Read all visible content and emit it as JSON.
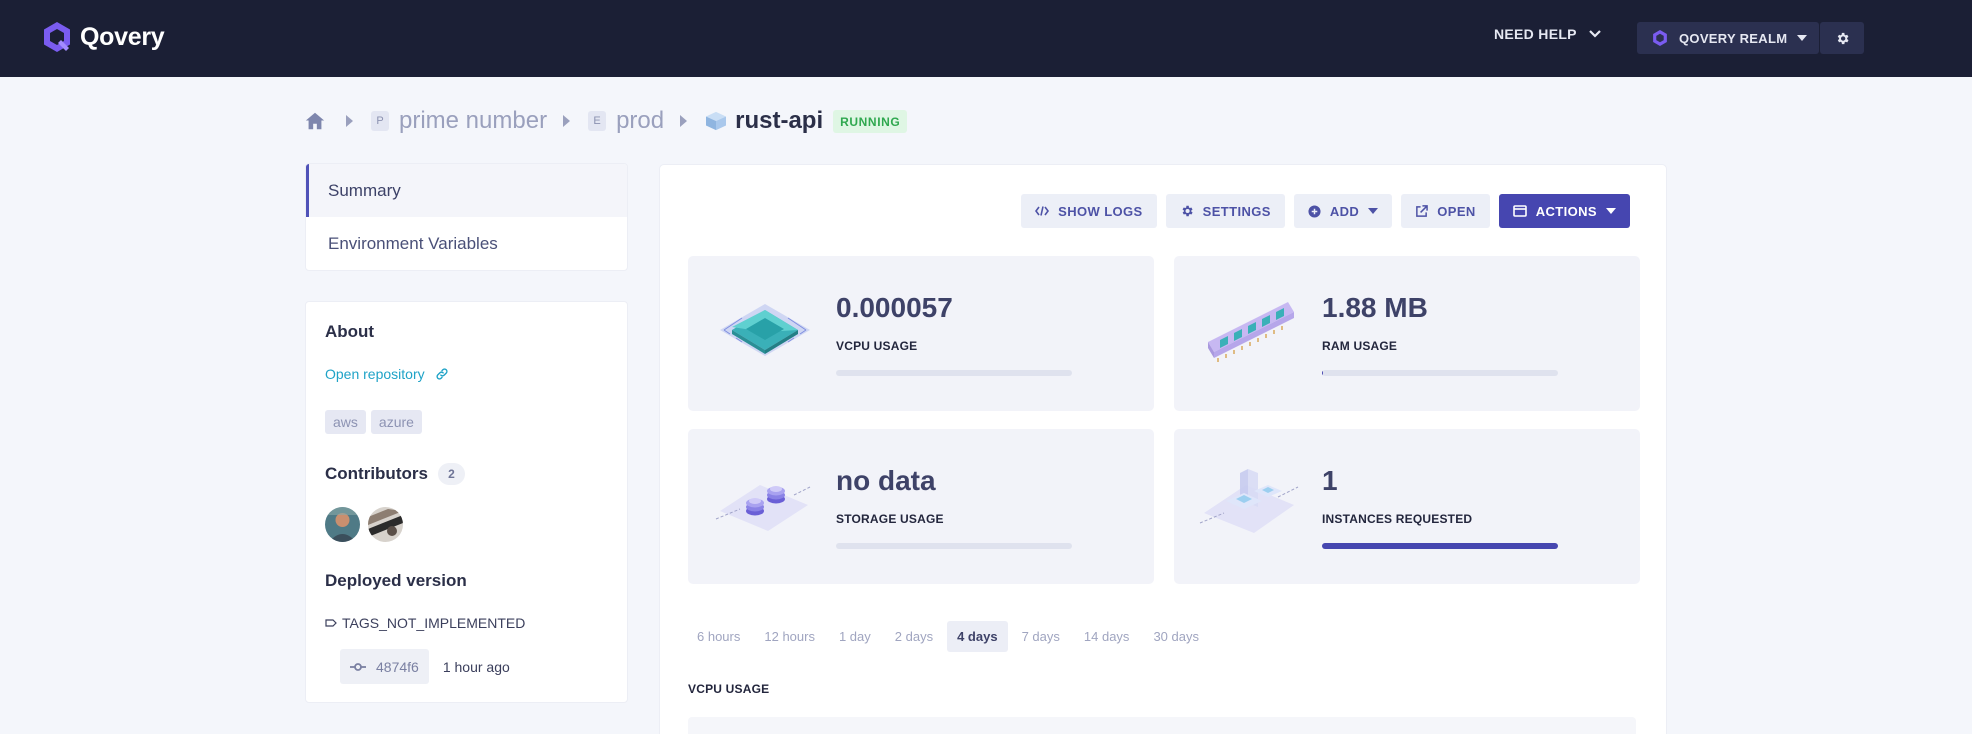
{
  "app": {
    "name": "Qovery"
  },
  "topbar": {
    "help_label": "NEED HELP",
    "realm_label": "QOVERY REALM"
  },
  "breadcrumb": {
    "project_letter": "P",
    "project": "prime number",
    "environment_letter": "E",
    "environment": "prod",
    "application": "rust-api",
    "status": "RUNNING"
  },
  "sidebar": {
    "items": [
      {
        "label": "Summary",
        "active": true
      },
      {
        "label": "Environment Variables",
        "active": false
      }
    ]
  },
  "about": {
    "title": "About",
    "repo_link": "Open repository",
    "tags": [
      "aws",
      "azure"
    ],
    "contributors_title": "Contributors",
    "contributors_count": "2",
    "deployed_title": "Deployed version",
    "tag_name": "TAGS_NOT_IMPLEMENTED",
    "commit": "4874f6",
    "commit_time": "1 hour ago"
  },
  "toolbar": {
    "show_logs": "SHOW LOGS",
    "settings": "SETTINGS",
    "add": "ADD",
    "open": "OPEN",
    "actions": "ACTIONS"
  },
  "metrics": {
    "vcpu": {
      "value": "0.000057",
      "label": "VCPU USAGE",
      "fill": 0
    },
    "ram": {
      "value": "1.88 MB",
      "label": "RAM USAGE",
      "fill": 0.005
    },
    "storage": {
      "value": "no data",
      "label": "STORAGE USAGE",
      "fill": 0
    },
    "instances": {
      "value": "1",
      "label": "INSTANCES REQUESTED",
      "fill": 1
    }
  },
  "time_ranges": {
    "options": [
      "6 hours",
      "12 hours",
      "1 day",
      "2 days",
      "4 days",
      "7 days",
      "14 days",
      "30 days"
    ],
    "selected": "4 days"
  },
  "chart_title": "VCPU USAGE",
  "colors": {
    "topbar": "#1b1f35",
    "accent": "#4646b0",
    "status_green": "#2fa84f",
    "link": "#1fa3c7"
  }
}
